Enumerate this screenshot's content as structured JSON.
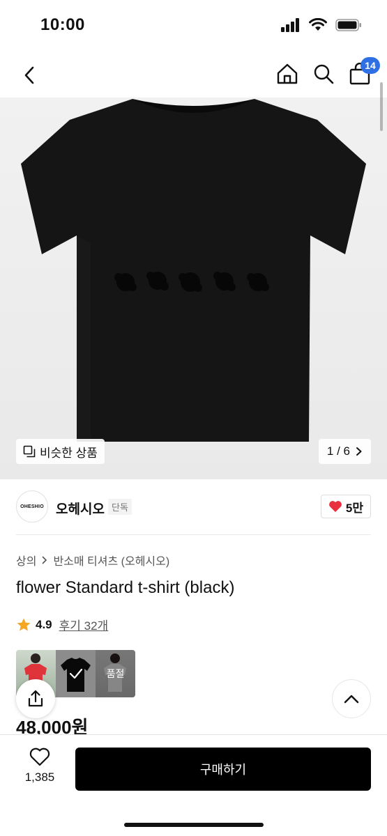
{
  "status_bar": {
    "time": "10:00"
  },
  "nav": {
    "cart_count": "14"
  },
  "hero": {
    "similar_label": "비슷한 상품",
    "counter": "1 / 6"
  },
  "brand": {
    "logo_text": "OHESHIO",
    "name": "오헤시오",
    "tag": "단독",
    "likes": "5만"
  },
  "breadcrumb": {
    "category": "상의",
    "subcategory": "반소매 티셔츠 (오헤시오)"
  },
  "product": {
    "title": "flower Standard t-shirt (black)",
    "rating": "4.9",
    "reviews": "후기 32개",
    "variants_sold_out_label": "품절",
    "price": "48,000원"
  },
  "bottom": {
    "wish_count": "1,385",
    "buy_label": "구매하기"
  },
  "colors": {
    "accent_badge": "#2f6fe4",
    "heart": "#e8303f",
    "star": "#f5a623",
    "buy_button": "#000000"
  },
  "icons": [
    "signal-icon",
    "wifi-icon",
    "battery-icon",
    "back-icon",
    "home-icon",
    "search-icon",
    "cart-icon",
    "copy-icon",
    "chevron-right-icon",
    "heart-icon",
    "star-icon",
    "check-icon",
    "share-icon",
    "chevron-up-icon",
    "heart-outline-icon"
  ]
}
